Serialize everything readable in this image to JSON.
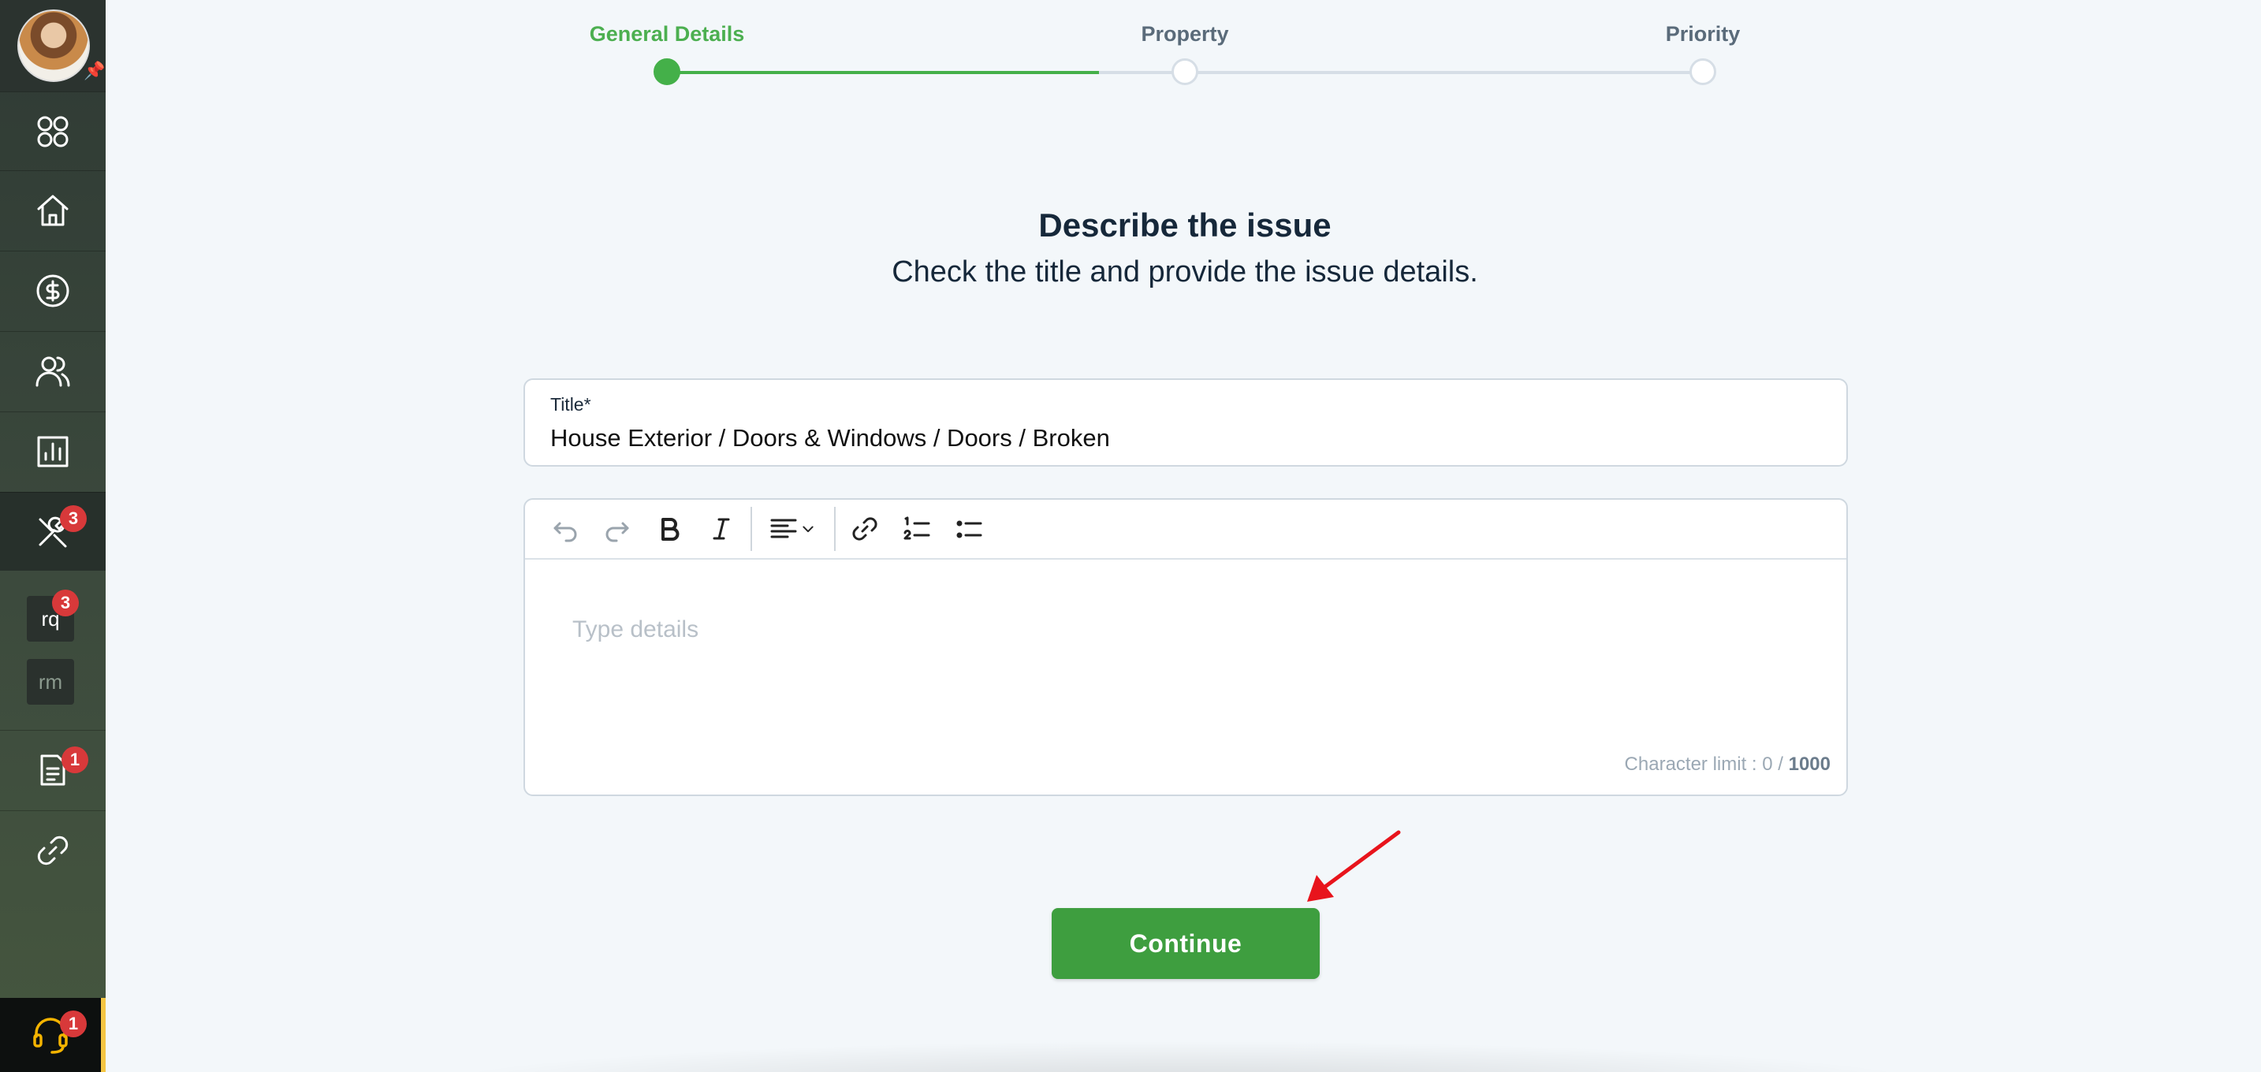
{
  "sidebar": {
    "badges": {
      "maintenance": "3",
      "rq": "3",
      "documents": "1",
      "support": "1"
    },
    "tiles": {
      "rq": "rq",
      "rm": "rm"
    }
  },
  "stepper": {
    "steps": [
      {
        "label": "General Details",
        "state": "done"
      },
      {
        "label": "Property",
        "state": "pending"
      },
      {
        "label": "Priority",
        "state": "pending"
      }
    ]
  },
  "form": {
    "heading": "Describe the issue",
    "subheading": "Check the title and provide the issue details.",
    "title_label": "Title*",
    "title_value": "House Exterior / Doors & Windows / Doors / Broken",
    "details_placeholder": "Type details",
    "char_limit_label": "Character limit : 0 /",
    "char_limit_max": "1000",
    "continue_label": "Continue"
  },
  "colors": {
    "accent_green": "#3e9e3f",
    "badge_red": "#d8393a",
    "annotation_arrow": "#e8141c"
  }
}
